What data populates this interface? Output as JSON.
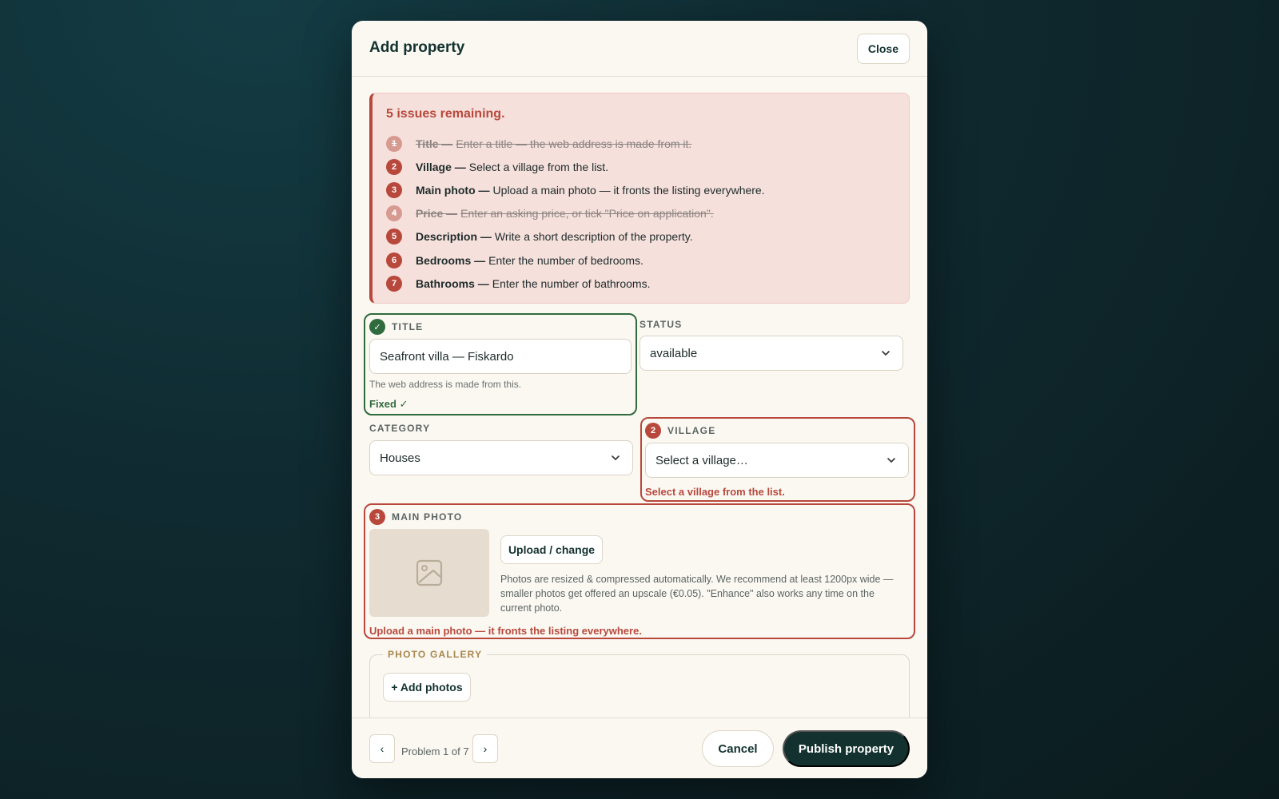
{
  "modal": {
    "title": "Add property",
    "close_label": "Close"
  },
  "issues": {
    "heading": "5 issues remaining.",
    "items": [
      {
        "num": "1",
        "label": "Title —",
        "text": "Enter a title — the web address is made from it.",
        "done": true
      },
      {
        "num": "2",
        "label": "Village —",
        "text": "Select a village from the list.",
        "done": false
      },
      {
        "num": "3",
        "label": "Main photo —",
        "text": "Upload a main photo — it fronts the listing everywhere.",
        "done": false
      },
      {
        "num": "4",
        "label": "Price —",
        "text": "Enter an asking price, or tick \"Price on application\".",
        "done": true
      },
      {
        "num": "5",
        "label": "Description —",
        "text": "Write a short description of the property.",
        "done": false
      },
      {
        "num": "6",
        "label": "Bedrooms —",
        "text": "Enter the number of bedrooms.",
        "done": false
      },
      {
        "num": "7",
        "label": "Bathrooms —",
        "text": "Enter the number of bathrooms.",
        "done": false
      }
    ]
  },
  "title_field": {
    "label": "TITLE",
    "value": "Seafront villa — Fiskardo",
    "help": "The web address is made from this.",
    "fixed": "Fixed ✓",
    "badge": "✓"
  },
  "status_field": {
    "label": "STATUS",
    "value": "available"
  },
  "category_field": {
    "label": "CATEGORY",
    "value": "Houses"
  },
  "village_field": {
    "badge": "2",
    "label": "VILLAGE",
    "value": "Select a village…",
    "error": "Select a village from the list."
  },
  "main_photo": {
    "badge": "3",
    "label": "MAIN PHOTO",
    "upload_label": "Upload / change",
    "help": "Photos are resized & compressed automatically. We recommend at least 1200px wide — smaller photos get offered an upscale (€0.05). \"Enhance\" also works any time on the current photo.",
    "error": "Upload a main photo — it fronts the listing everywhere."
  },
  "gallery": {
    "legend": "PHOTO GALLERY",
    "add_label": "+ Add photos"
  },
  "footer": {
    "prev": "‹",
    "next": "›",
    "pager_text": "Problem 1 of 7",
    "cancel_label": "Cancel",
    "publish_label": "Publish property"
  },
  "colors": {
    "accent_dark": "#13322f",
    "error": "#b8483c",
    "success": "#2f6b3d",
    "gallery_label": "#a8874c"
  }
}
